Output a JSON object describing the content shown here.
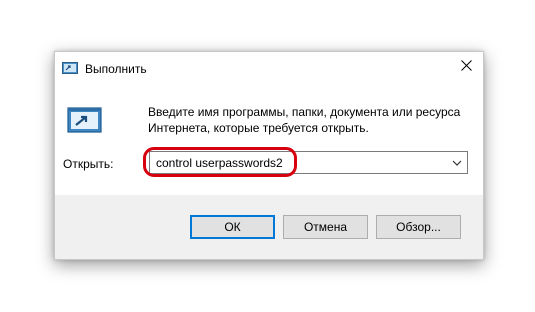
{
  "window": {
    "title": "Выполнить",
    "close_glyph": "✕",
    "title_icon": "run-dialog-icon"
  },
  "content": {
    "description": "Введите имя программы, папки, документа или ресурса Интернета, которые требуется открыть.",
    "icon": "run-program-icon",
    "open_label": "Открыть:",
    "command_value": "control userpasswords2",
    "dropdown_icon": "chevron-down-icon"
  },
  "buttons": {
    "ok": "ОК",
    "cancel": "Отмена",
    "browse": "Обзор..."
  },
  "colors": {
    "highlight": "#d7000f",
    "default_button_border": "#0078d7",
    "footer_background": "#f0f0f0",
    "button_background": "#e1e1e1"
  }
}
